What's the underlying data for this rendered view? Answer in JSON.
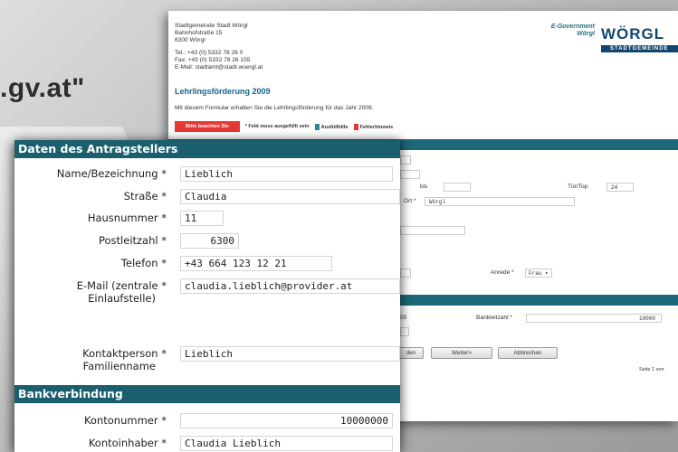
{
  "background": {
    "domain_fragment": ".gv.at\""
  },
  "back_form": {
    "address": {
      "line1": "Stadtgemeinde Stadt Wörgl",
      "line2": "Bahnhofstraße 15",
      "line3": "6300 Wörgl",
      "phone": "Tel.: +43 (0) 5332 78 26 0",
      "fax": "Fax: +43 (0) 5332 78 26 155",
      "email": "E-Mail: stadtamt@stadt.woergl.at"
    },
    "egov_line1": "E-Government",
    "egov_line2": "Wörgl",
    "logo": "WÖRGL",
    "logo_sub": "STADTGEMEINDE",
    "title": "Lehrlingsförderung 2009",
    "intro": "Mit diesem Formular erhalten Sie die Lehrlingsförderung für das Jahr 2009.",
    "legend": {
      "note_button": "Bitte beachten Sie",
      "required": "* Feld muss ausgefüllt sein",
      "help": "Ausfüllhilfe",
      "error": "Fehlerhinweis"
    },
    "fields": {
      "bis_label": "bis",
      "tuer_label": "Tür/Top",
      "tuer_value": "24",
      "ort_label": "Ort *",
      "ort_value": "Wörgl",
      "anrede_label": "Anrede *",
      "anrede_value": "Frau ▾",
      "blz_label": "Bankleitzahl *",
      "blz_value": "10000",
      "partial_value": "00"
    },
    "buttons": {
      "back_partial": "den",
      "next": "Weiter>",
      "cancel": "Abbrechen"
    },
    "page_info": "Seite 1 von"
  },
  "front_form": {
    "section_applicant": "Daten des Antragstellers",
    "section_bank": "Bankverbindung",
    "fields": {
      "name_label": "Name/Bezeichnung *",
      "name_value": "Lieblich",
      "street_label": "Straße *",
      "street_value": "Claudia",
      "house_label": "Hausnummer *",
      "house_value": "11",
      "zip_label": "Postleitzahl *",
      "zip_value": "6300",
      "phone_label": "Telefon *",
      "phone_value": "+43 664 123 12 21",
      "email_label_1": "E-Mail (zentrale *",
      "email_label_2": "Einlaufstelle)",
      "email_value": "claudia.lieblich@provider.at",
      "contact_label_1": "Kontaktperson *",
      "contact_label_2": "Familienname",
      "contact_value": "Lieblich",
      "account_label": "Kontonummer *",
      "account_value": "10000000",
      "holder_label": "Kontoinhaber *",
      "holder_value": "Claudia Lieblich"
    }
  },
  "colors": {
    "section_bar": "#1b5f6e",
    "title_blue": "#14668a",
    "legend_red": "#e53935"
  }
}
